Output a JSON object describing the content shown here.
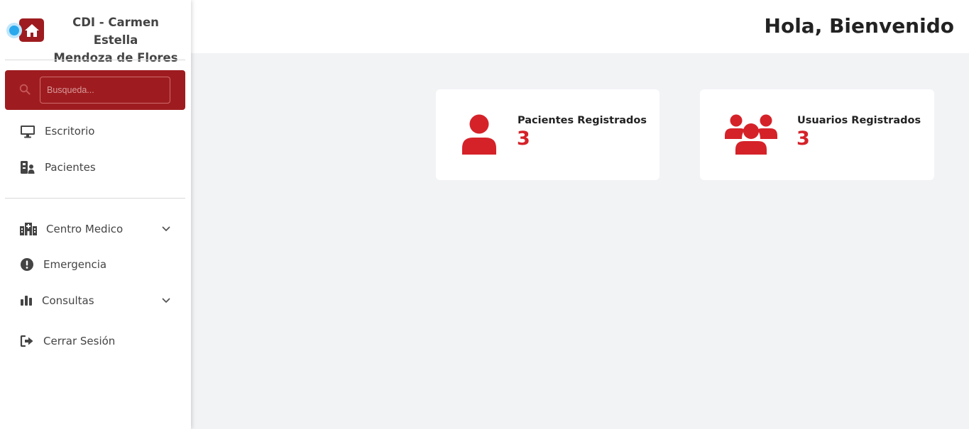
{
  "brand": {
    "title_line1": "CDI - Carmen Estella",
    "title_line2": "Mendoza de Flores"
  },
  "search": {
    "placeholder": "Busqueda..."
  },
  "sidebar": {
    "items": [
      {
        "label": "Escritorio",
        "icon": "desktop-icon"
      },
      {
        "label": "Pacientes",
        "icon": "patient-id-icon"
      },
      {
        "label": "Centro Medico",
        "icon": "hospital-icon",
        "expandable": true
      },
      {
        "label": "Emergencia",
        "icon": "exclamation-circle-icon"
      },
      {
        "label": "Consultas",
        "icon": "bar-chart-icon",
        "expandable": true
      },
      {
        "label": "Cerrar Sesión",
        "icon": "logout-icon"
      }
    ]
  },
  "header": {
    "greeting": "Hola, Bienvenido"
  },
  "cards": [
    {
      "label": "Pacientes Registrados",
      "value": "3",
      "icon": "user-icon"
    },
    {
      "label": "Usuarios Registrados",
      "value": "3",
      "icon": "users-group-icon"
    }
  ],
  "colors": {
    "brand": "#9e1c1f",
    "accent": "#d52229",
    "background": "#f2f3f5",
    "text": "#444444"
  }
}
